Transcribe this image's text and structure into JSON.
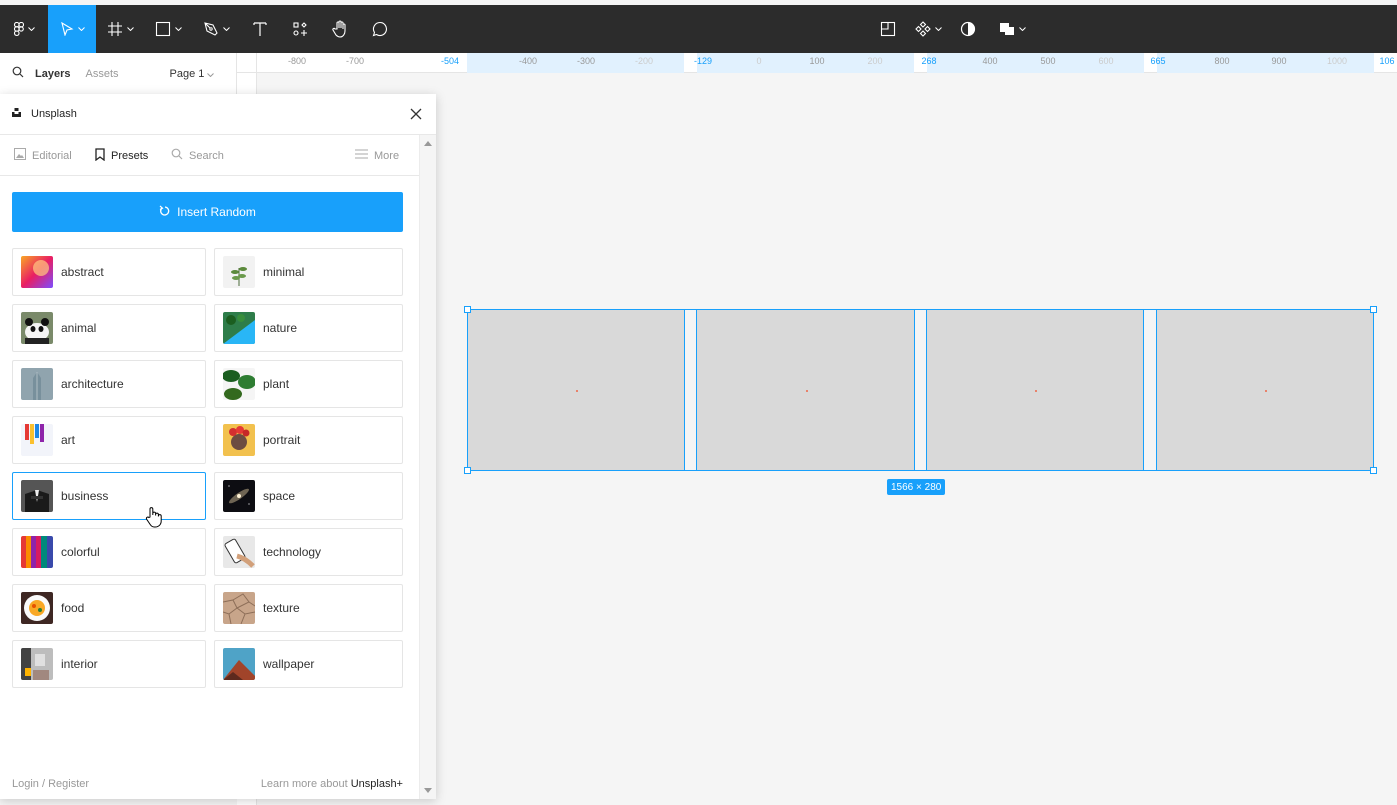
{
  "colors": {
    "accent": "#18a0fb",
    "toolbar": "#2c2c2c",
    "canvas": "#f5f5f5",
    "frame_fill": "#d9d9d9"
  },
  "toolbar": {
    "tools": [
      "figma-menu-icon",
      "move-tool-icon",
      "frame-tool-icon",
      "shape-tool-icon",
      "pen-tool-icon",
      "text-tool-icon",
      "resources-icon",
      "hand-tool-icon",
      "comment-icon"
    ],
    "center_tools": [
      "mask-icon",
      "component-icon",
      "contrast-icon",
      "boolean-icon"
    ]
  },
  "layers_panel": {
    "tab_layers": "Layers",
    "tab_assets": "Assets",
    "page": "Page 1"
  },
  "ruler": {
    "ticks": [
      "-800",
      "-700",
      "-504",
      "-400",
      "-300",
      "-200",
      "-129",
      "0",
      "100",
      "200",
      "268",
      "400",
      "500",
      "600",
      "665",
      "800",
      "900",
      "1000",
      "106"
    ]
  },
  "plugin": {
    "title": "Unsplash",
    "tabs": {
      "editorial": "Editorial",
      "presets": "Presets",
      "search": "Search",
      "more": "More"
    },
    "insert_random": "Insert Random",
    "presets": [
      "abstract",
      "minimal",
      "animal",
      "nature",
      "architecture",
      "plant",
      "art",
      "portrait",
      "business",
      "space",
      "colorful",
      "technology",
      "food",
      "texture",
      "interior",
      "wallpaper"
    ],
    "selected_preset": "business",
    "footer": {
      "login": "Login / Register",
      "learn_prefix": "Learn more about ",
      "learn_brand": "Unsplash+"
    }
  },
  "canvas": {
    "size_label": "1566 × 280",
    "frame_count": 4
  }
}
